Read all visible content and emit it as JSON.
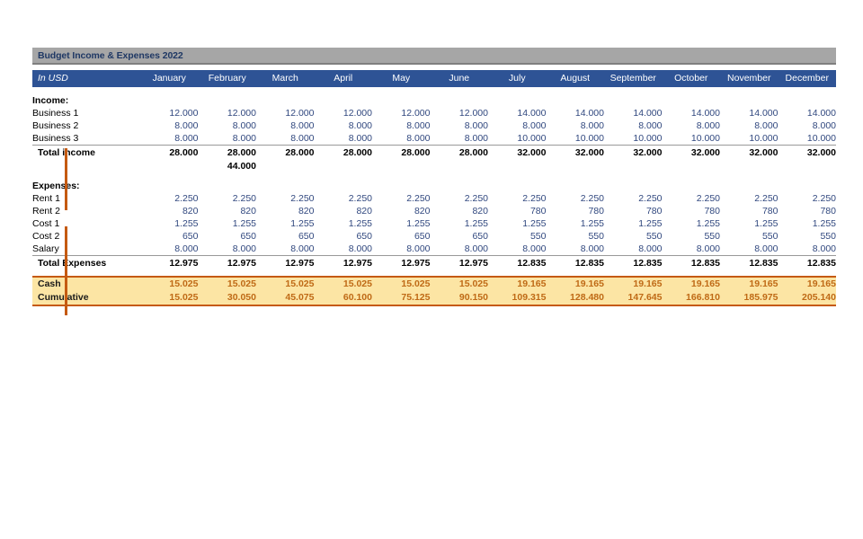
{
  "sheet": {
    "title": "Budget Income & Expenses 2022",
    "label_header": "In USD",
    "months": [
      "January",
      "February",
      "March",
      "April",
      "May",
      "June",
      "July",
      "August",
      "September",
      "October",
      "November",
      "December"
    ],
    "income_section_label": "Income:",
    "expenses_section_label": "Expenses:",
    "income_rows": [
      {
        "label": "Business 1",
        "values": [
          "12.000",
          "12.000",
          "12.000",
          "12.000",
          "12.000",
          "12.000",
          "14.000",
          "14.000",
          "14.000",
          "14.000",
          "14.000",
          "14.000"
        ]
      },
      {
        "label": "Business 2",
        "values": [
          "8.000",
          "8.000",
          "8.000",
          "8.000",
          "8.000",
          "8.000",
          "8.000",
          "8.000",
          "8.000",
          "8.000",
          "8.000",
          "8.000"
        ]
      },
      {
        "label": "Business 3",
        "values": [
          "8.000",
          "8.000",
          "8.000",
          "8.000",
          "8.000",
          "8.000",
          "10.000",
          "10.000",
          "10.000",
          "10.000",
          "10.000",
          "10.000"
        ]
      }
    ],
    "total_income": {
      "label": "Total income",
      "values": [
        "28.000",
        "28.000",
        "28.000",
        "28.000",
        "28.000",
        "28.000",
        "32.000",
        "32.000",
        "32.000",
        "32.000",
        "32.000",
        "32.000"
      ]
    },
    "extra_row": {
      "label": "",
      "values": [
        "",
        "44.000",
        "",
        "",
        "",
        "",
        "",
        "",
        "",
        "",
        "",
        ""
      ]
    },
    "expense_rows": [
      {
        "label": "Rent 1",
        "values": [
          "2.250",
          "2.250",
          "2.250",
          "2.250",
          "2.250",
          "2.250",
          "2.250",
          "2.250",
          "2.250",
          "2.250",
          "2.250",
          "2.250"
        ]
      },
      {
        "label": "Rent 2",
        "values": [
          "820",
          "820",
          "820",
          "820",
          "820",
          "820",
          "780",
          "780",
          "780",
          "780",
          "780",
          "780"
        ]
      },
      {
        "label": "Cost 1",
        "values": [
          "1.255",
          "1.255",
          "1.255",
          "1.255",
          "1.255",
          "1.255",
          "1.255",
          "1.255",
          "1.255",
          "1.255",
          "1.255",
          "1.255"
        ]
      },
      {
        "label": "Cost 2",
        "values": [
          "650",
          "650",
          "650",
          "650",
          "650",
          "650",
          "550",
          "550",
          "550",
          "550",
          "550",
          "550"
        ]
      },
      {
        "label": "Salary",
        "values": [
          "8.000",
          "8.000",
          "8.000",
          "8.000",
          "8.000",
          "8.000",
          "8.000",
          "8.000",
          "8.000",
          "8.000",
          "8.000",
          "8.000"
        ]
      }
    ],
    "total_expenses": {
      "label": "Total Expenses",
      "values": [
        "12.975",
        "12.975",
        "12.975",
        "12.975",
        "12.975",
        "12.975",
        "12.835",
        "12.835",
        "12.835",
        "12.835",
        "12.835",
        "12.835"
      ]
    },
    "cash_rows": [
      {
        "label": "Cash",
        "values": [
          "15.025",
          "15.025",
          "15.025",
          "15.025",
          "15.025",
          "15.025",
          "19.165",
          "19.165",
          "19.165",
          "19.165",
          "19.165",
          "19.165"
        ]
      },
      {
        "label": "Cumulative",
        "values": [
          "15.025",
          "30.050",
          "45.075",
          "60.100",
          "75.125",
          "90.150",
          "109.315",
          "128.480",
          "147.645",
          "166.810",
          "185.975",
          "205.140"
        ]
      }
    ],
    "colors": {
      "title_bar": "#A6A6A6",
      "header_blue": "#2E5395",
      "accent_orange": "#C55A11",
      "cash_fill": "#FCE5A4",
      "cash_text": "#BF6A16",
      "number_blue": "#31487F"
    }
  }
}
